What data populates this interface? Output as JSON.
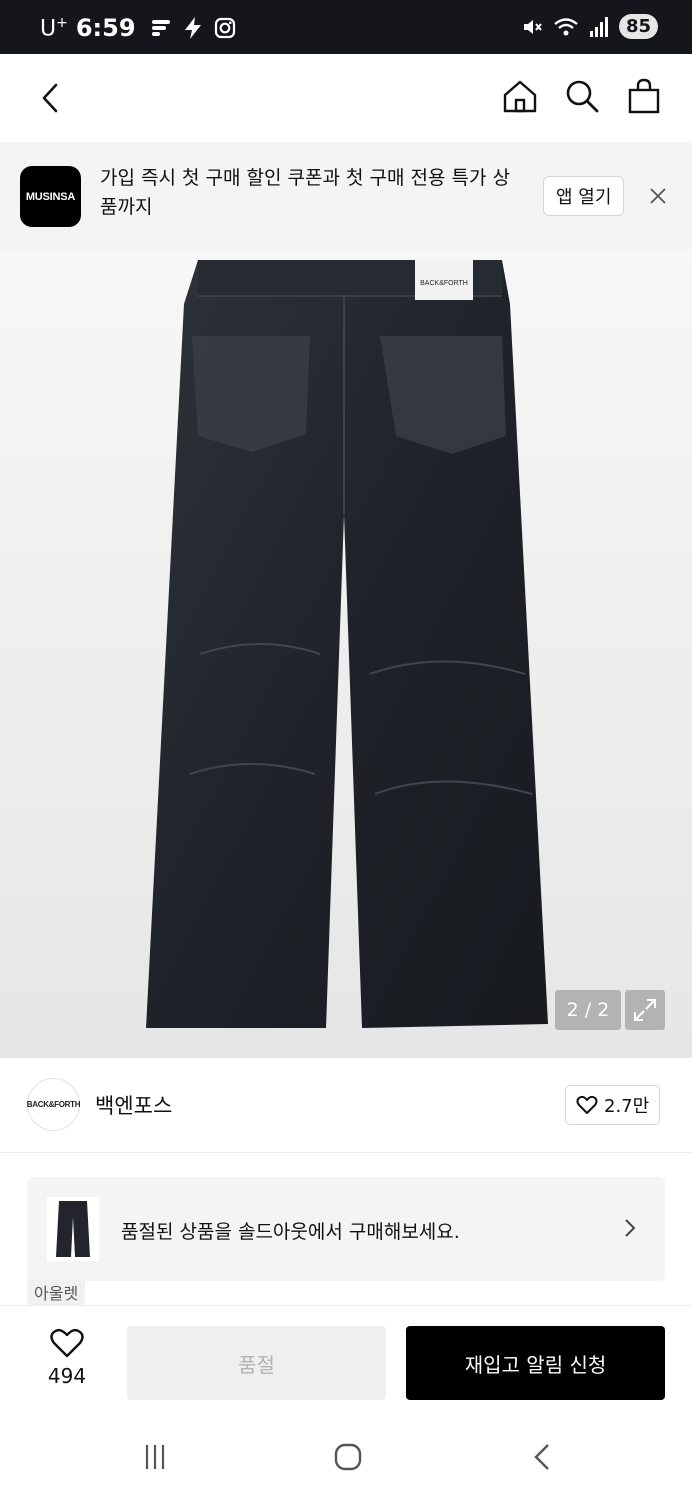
{
  "status_bar": {
    "carrier": "U",
    "carrier_sup": "+",
    "time": "6:59",
    "battery": "85",
    "icons_left": [
      "fire-app-icon",
      "bolt-icon",
      "instagram-icon"
    ],
    "icons_right": [
      "mute-icon",
      "wifi-icon",
      "signal-icon"
    ]
  },
  "top_nav": {
    "icons": [
      "back-icon",
      "home-icon",
      "search-icon",
      "shopping-bag-icon"
    ]
  },
  "app_banner": {
    "logo_text": "MUSINSA",
    "message": "가입 즉시 첫 구매 할인 쿠폰과 첫 구매 전용 특가 상품까지",
    "open_label": "앱 열기"
  },
  "product_image": {
    "tag_text": "BACK&FORTH",
    "counter": "2 / 2"
  },
  "brand": {
    "avatar_text": "BACK&FORTH",
    "name": "백엔포스",
    "likes": "2.7만"
  },
  "soldout_card": {
    "text": "품절된 상품을 솔드아웃에서 구매해보세요."
  },
  "tag_label": "아울렛",
  "action_bar": {
    "wish_count": "494",
    "soldout_label": "품절",
    "restock_label": "재입고 알림 신청"
  },
  "colors": {
    "status_bar_bg": "#15161b",
    "primary_button": "#000000",
    "disabled_button": "#efefef",
    "banner_bg": "#f4f4f4"
  }
}
